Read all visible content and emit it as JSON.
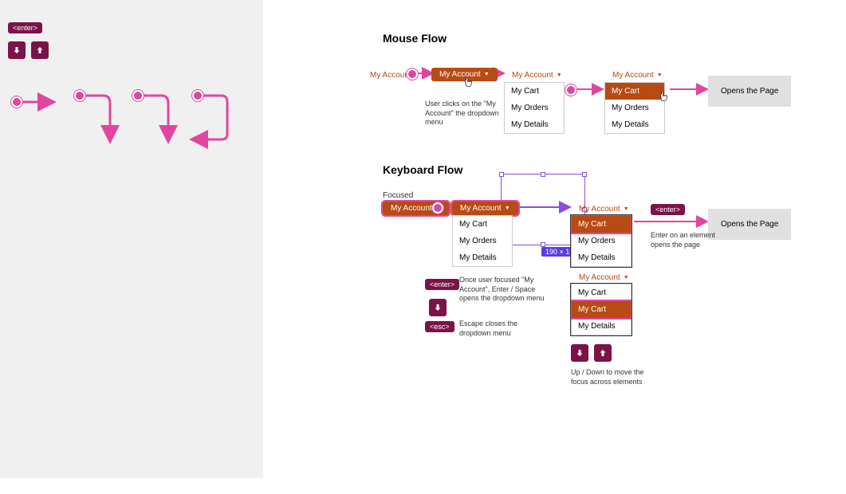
{
  "sidebar": {
    "enter_key": "<enter>"
  },
  "mouse_flow": {
    "title": "Mouse Flow",
    "link1": "My Account",
    "pill1": "My Account",
    "caption1": "User clicks on the \"My Account\" the dropdown menu",
    "link2": "My Account",
    "menu1": {
      "i1": "My Cart",
      "i2": "My Orders",
      "i3": "My Details"
    },
    "link3": "My Account",
    "menu2": {
      "i1": "My Cart",
      "i2": "My Orders",
      "i3": "My Details"
    },
    "page": "Opens the Page"
  },
  "keyboard_flow": {
    "title": "Keyboard Flow",
    "focused": "Focused",
    "pill1": "My Account",
    "pill2": "My Account",
    "menu1": {
      "i1": "My Cart",
      "i2": "My Orders",
      "i3": "My Details"
    },
    "link3": "My Account",
    "menu2": {
      "i1": "My Cart",
      "i2": "My Orders",
      "i3": "My Details"
    },
    "enter_key": "<enter>",
    "page": "Opens the Page",
    "cap_enter": "Enter on an element opens the page",
    "legend_enter_key": "<enter>",
    "legend_enter_text": "Once user focused \"My Account\", Enter / Space opens the dropdown menu",
    "legend_esc_key": "<esc>",
    "legend_esc_text": "Escape closes the dropdown menu",
    "link4": "My Account",
    "menu3": {
      "i1": "My Cart",
      "i2": "My Cart",
      "i3": "My Details"
    },
    "cap_updown": "Up / Down to move the focus across elements",
    "dim_label": "190 × 162"
  },
  "colors": {
    "pink": "#e046a0",
    "orange": "#b84a14",
    "purple_key": "#7b1248",
    "selection": "#8a4be0",
    "gray_box": "#e0e0e0"
  }
}
